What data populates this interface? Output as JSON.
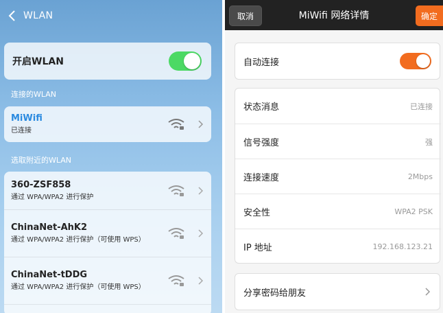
{
  "left": {
    "header_title": "WLAN",
    "wlan_toggle_label": "开启WLAN",
    "wlan_enabled": true,
    "connected_section_label": "连接的WLAN",
    "connected": {
      "name": "MiWifi",
      "status": "已连接"
    },
    "nearby_section_label": "选取附近的WLAN",
    "networks": [
      {
        "name": "360-ZSF858",
        "security": "通过 WPA/WPA2 进行保护"
      },
      {
        "name": "ChinaNet-AhK2",
        "security": "通过 WPA/WPA2 进行保护（可使用 WPS）"
      },
      {
        "name": "ChinaNet-tDDG",
        "security": "通过 WPA/WPA2 进行保护（可使用 WPS）"
      }
    ]
  },
  "right": {
    "cancel_label": "取消",
    "title": "MiWifi 网络详情",
    "confirm_label": "确定",
    "auto_connect_label": "自动连接",
    "auto_connect_enabled": true,
    "info": [
      {
        "label": "状态消息",
        "value": "已连接"
      },
      {
        "label": "信号强度",
        "value": "强"
      },
      {
        "label": "连接速度",
        "value": "2Mbps"
      },
      {
        "label": "安全性",
        "value": "WPA2 PSK"
      },
      {
        "label": "IP 地址",
        "value": "192.168.123.21"
      }
    ],
    "share_label": "分享密码给朋友"
  },
  "colors": {
    "toggle_green": "#4cd964",
    "accent_orange": "#f26c1f",
    "connected_blue": "#2a8ae0"
  }
}
